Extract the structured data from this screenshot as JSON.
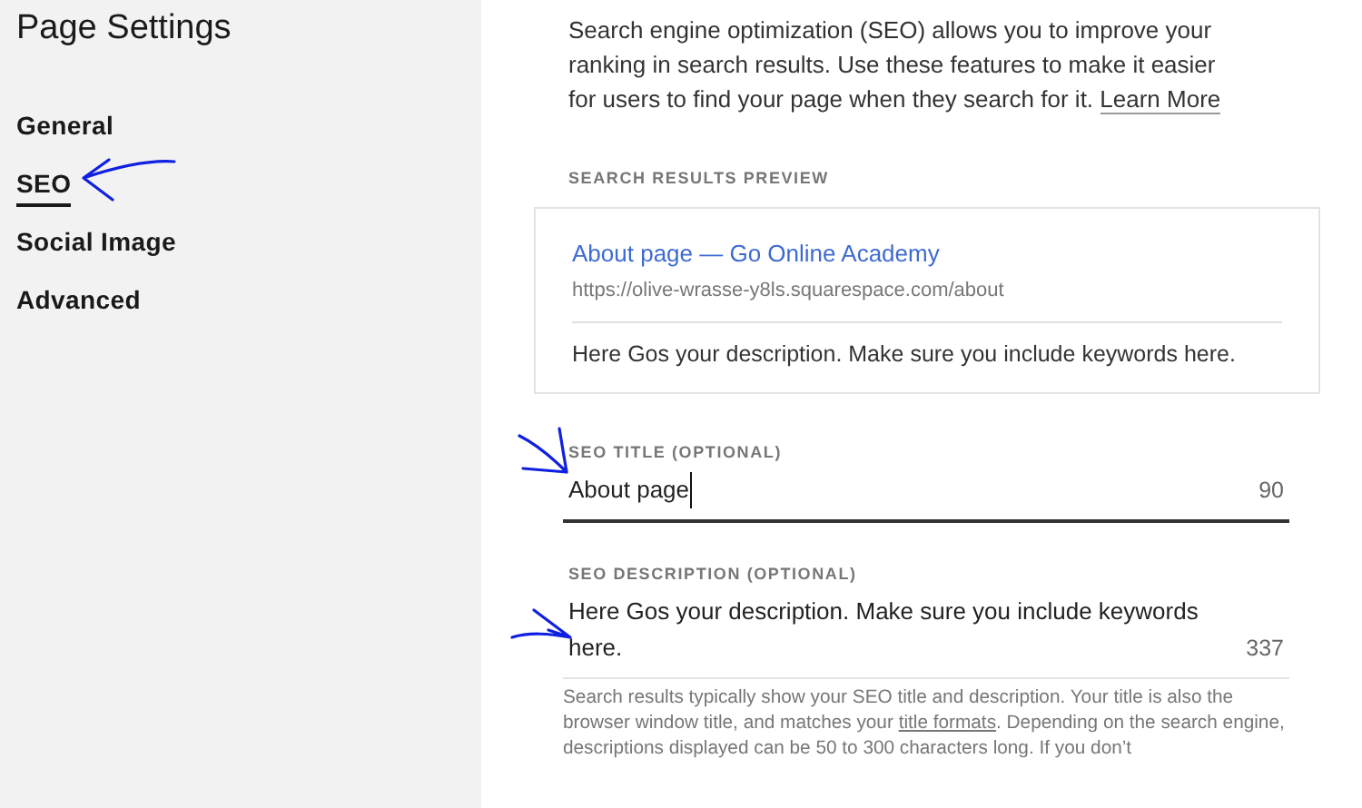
{
  "sidebar": {
    "title": "Page Settings",
    "items": [
      {
        "label": "General",
        "selected": false
      },
      {
        "label": "SEO",
        "selected": true
      },
      {
        "label": "Social Image",
        "selected": false
      },
      {
        "label": "Advanced",
        "selected": false
      }
    ]
  },
  "intro": {
    "text": "Search engine optimization (SEO) allows you to improve your ranking in search results. Use these features to make it easier for users to find your page when they search for it. ",
    "link": "Learn More"
  },
  "preview": {
    "heading": "SEARCH RESULTS PREVIEW",
    "title": "About page — Go Online Academy",
    "url": "https://olive-wrasse-y8ls.squarespace.com/about",
    "description": "Here Gos your description. Make sure you include keywords here."
  },
  "fields": [
    {
      "label": "SEO TITLE (OPTIONAL)",
      "value": "About page",
      "count": "90",
      "focused": true
    },
    {
      "label": "SEO DESCRIPTION (OPTIONAL)",
      "value": "Here Gos your description. Make sure you include keywords here.",
      "count": "337",
      "focused": false
    }
  ],
  "help": {
    "before": "Search results typically show your SEO title and description. Your title is also the browser window title, and matches your ",
    "link": "title formats",
    "after": ". Depending on the search engine, descriptions displayed can be 50 to 300 characters long. If you don’t"
  }
}
